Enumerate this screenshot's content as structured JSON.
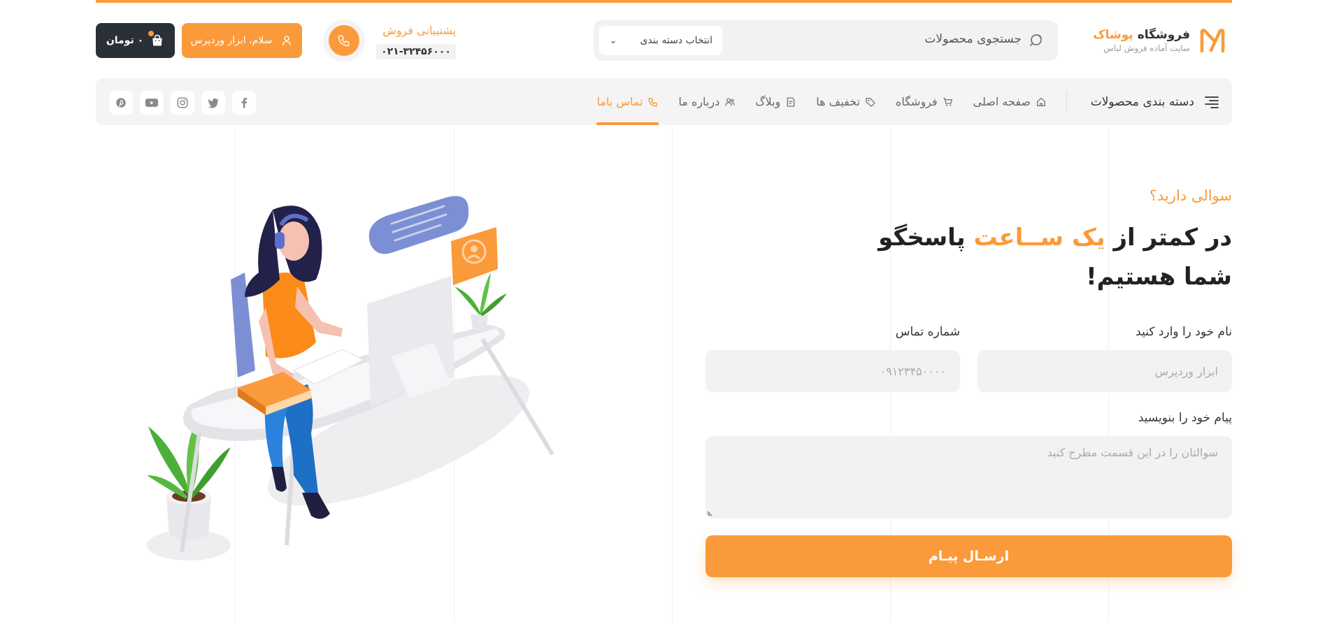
{
  "brand": {
    "title_main": "فروشگاه",
    "title_accent": "پوشاک",
    "subtitle": "سایت آماده فروش لباس",
    "accent_color": "#fb9a3a",
    "dark_color": "#2b2f36"
  },
  "search": {
    "placeholder": "جستجوی محصولات",
    "category_select": "انتخاب دسته بندی"
  },
  "support": {
    "title": "پشتیبانی فروش",
    "phone": "۰۲۱-۳۲۴۵۶۰۰۰"
  },
  "account": {
    "greeting": "سلام، ابزار وردپرس"
  },
  "cart": {
    "total": "۰ تومان"
  },
  "nav": {
    "categories_label": "دسته بندی محصولات",
    "items": [
      {
        "label": "صفحه اصلی",
        "icon": "home-icon"
      },
      {
        "label": "فروشگاه",
        "icon": "cart-icon"
      },
      {
        "label": "تخفیف ها",
        "icon": "tag-icon"
      },
      {
        "label": "وبلاگ",
        "icon": "blog-icon"
      },
      {
        "label": "درباره ما",
        "icon": "users-icon"
      },
      {
        "label": "تماس باما",
        "icon": "phone-icon",
        "active": true
      }
    ],
    "socials": [
      "facebook-icon",
      "twitter-icon",
      "instagram-icon",
      "youtube-icon",
      "pinterest-icon"
    ]
  },
  "contact": {
    "question": "سوالی دارید؟",
    "headline_pre": "در کمتر از ",
    "headline_accent": "یک ســاعت",
    "headline_post": " پاسخگو شما هستیم!",
    "name_label": "نام خود را وارد کنید",
    "name_placeholder": "ابزار وردپرس",
    "phone_label": "شماره تماس",
    "phone_placeholder": "۰۹۱۲۳۴۵۰۰۰۰",
    "message_label": "پیام خود را بنویسید",
    "message_placeholder": "سوالتان را در این قسمت مطرح کنید",
    "submit_label": "ارسـال پیـام"
  }
}
